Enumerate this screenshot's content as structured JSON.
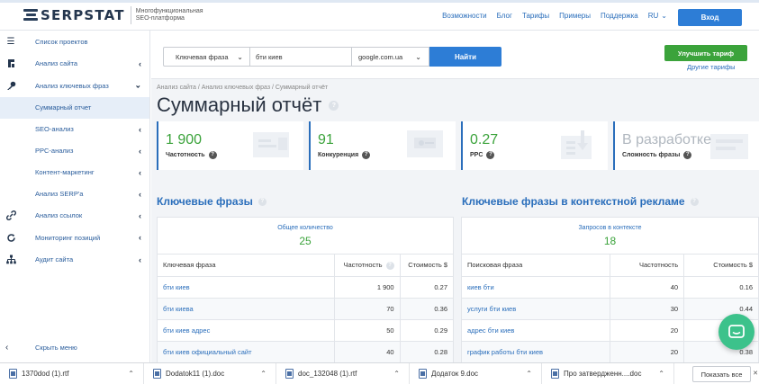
{
  "brand": {
    "name": "SERPSTAT",
    "tagline_line1": "Многофункциональная",
    "tagline_line2": "SEO-платформа"
  },
  "topnav": {
    "items": [
      "Возможности",
      "Блог",
      "Тарифы",
      "Примеры",
      "Поддержка"
    ],
    "language": "RU",
    "login_label": "Вход"
  },
  "sidebar": {
    "items": [
      {
        "label": "Список проектов",
        "icon": "menu-icon"
      },
      {
        "label": "Анализ сайта",
        "icon": "site-analysis-icon"
      },
      {
        "label": "Анализ ключевых фраз",
        "icon": "key-icon"
      },
      {
        "label": "Суммарный отчет"
      },
      {
        "label": "SEO-анализ"
      },
      {
        "label": "PPC-анализ"
      },
      {
        "label": "Контент-маркетинг"
      },
      {
        "label": "Анализ SERP'а"
      },
      {
        "label": "Анализ ссылок",
        "icon": "link-icon"
      },
      {
        "label": "Мониторинг позиций",
        "icon": "refresh-icon"
      },
      {
        "label": "Аудит сайта",
        "icon": "sitemap-icon"
      }
    ],
    "collapse_label": "Скрыть меню"
  },
  "search": {
    "type_value": "Ключевая фраза",
    "query_value": "бти киев",
    "database_value": "google.com.ua",
    "find_label": "Найти"
  },
  "upgrade": {
    "button_label": "Улучшить тариф",
    "other_plans_label": "Другие тарифы"
  },
  "breadcrumb": "Анализ сайта / Анализ ключевых фраз / Суммарный отчёт",
  "page_title": "Суммарный отчёт",
  "stats": [
    {
      "value": "1 900",
      "label": "Частотность"
    },
    {
      "value": "91",
      "label": "Конкуренция"
    },
    {
      "value": "0.27",
      "label": "PPC"
    },
    {
      "value": "В разработке",
      "label": "Сложность фразы"
    }
  ],
  "keywords": {
    "title": "Ключевые фразы",
    "total_label": "Общее количество",
    "total_value": "25",
    "columns": [
      "Ключевая фраза",
      "Частотность",
      "Стоимость $"
    ],
    "rows": [
      [
        "бти киев",
        "1 900",
        "0.27"
      ],
      [
        "бти киева",
        "70",
        "0.36"
      ],
      [
        "бти киев адрес",
        "50",
        "0.29"
      ],
      [
        "бти киев официальный сайт",
        "40",
        "0.28"
      ]
    ]
  },
  "ppc_keywords": {
    "title": "Ключевые фразы в контекстной рекламе",
    "total_label": "Запросов в контексте",
    "total_value": "18",
    "columns": [
      "Поисковая фраза",
      "Частотность",
      "Стоимость $"
    ],
    "rows": [
      [
        "киев бти",
        "40",
        "0.16"
      ],
      [
        "услуги бти киев",
        "30",
        "0.44"
      ],
      [
        "адрес бти киев",
        "20",
        ""
      ],
      [
        "график работы бти киев",
        "20",
        "0.38"
      ]
    ]
  },
  "downloads": {
    "items": [
      "1370dod (1).rtf",
      "Dodatok11 (1).doc",
      "doc_132048 (1).rtf",
      "Додаток 9.doc",
      "Про затвердженн....doc"
    ],
    "show_all_label": "Показать все",
    "close_label": "✕"
  },
  "colors": {
    "accent_blue": "#2d7dd6",
    "value_green": "#3ba33b",
    "chat_green": "#3cc28b"
  }
}
